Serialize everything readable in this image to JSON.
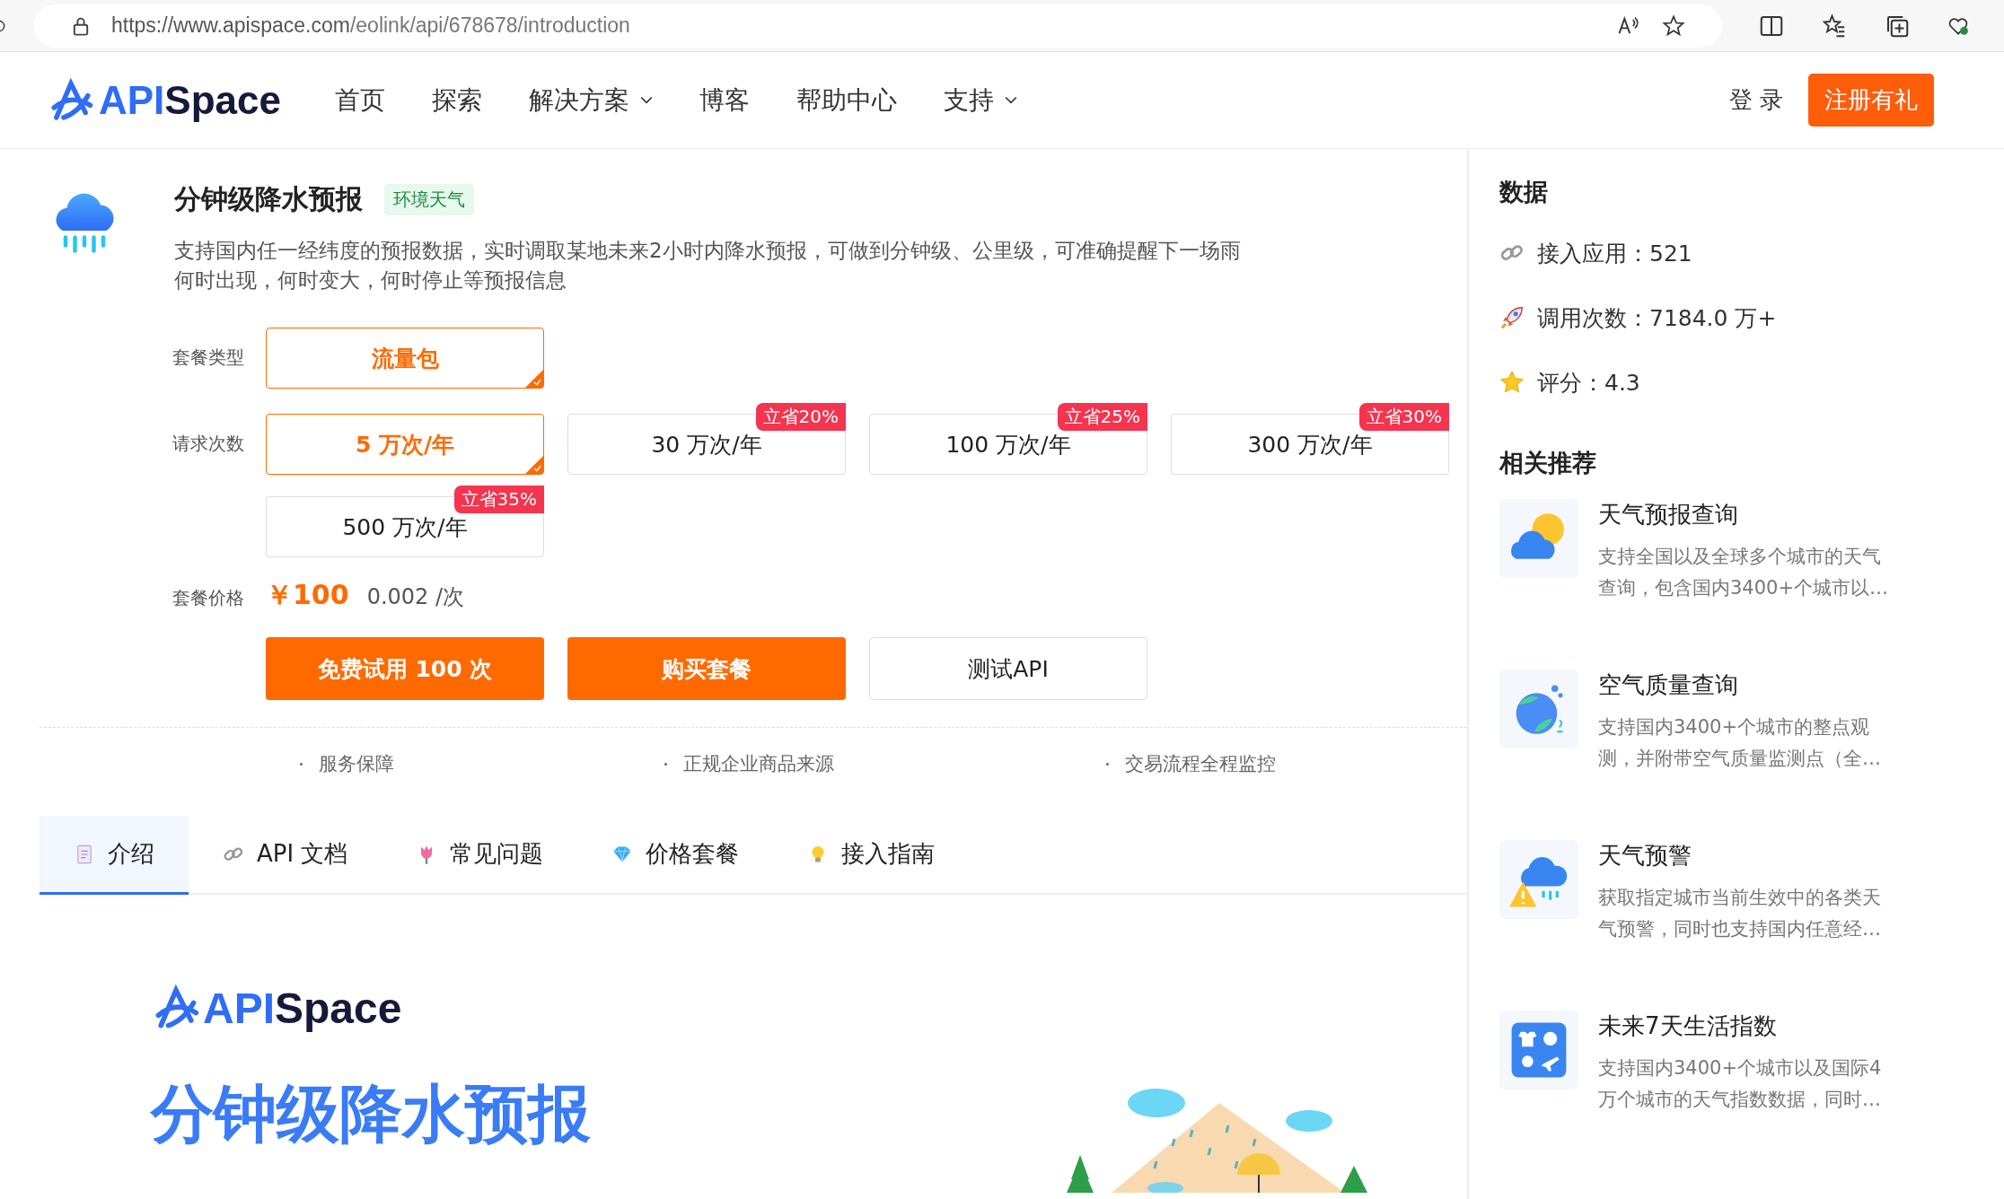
{
  "browser": {
    "url_host": "https://www.apispace.com",
    "url_path": "/eolink/api/678678/introduction"
  },
  "header": {
    "logo": {
      "prefix": "API",
      "suffix": "Space"
    },
    "nav": [
      {
        "label": "首页",
        "has_menu": false
      },
      {
        "label": "探索",
        "has_menu": false
      },
      {
        "label": "解决方案",
        "has_menu": true
      },
      {
        "label": "博客",
        "has_menu": false
      },
      {
        "label": "帮助中心",
        "has_menu": false
      },
      {
        "label": "支持",
        "has_menu": true
      }
    ],
    "login": "登 录",
    "register": "注册有礼"
  },
  "product": {
    "title": "分钟级降水预报",
    "tag": "环境天气",
    "description": "支持国内任一经纬度的预报数据，实时调取某地未来2小时内降水预报，可做到分钟级、公里级，可准确提醒下一场雨何时出现，何时变大，何时停止等预报信息",
    "package_type": {
      "label": "套餐类型",
      "options": [
        {
          "label": "流量包",
          "selected": true
        }
      ]
    },
    "request_count": {
      "label": "请求次数",
      "options": [
        {
          "label": "5 万次/年",
          "selected": true
        },
        {
          "label": "30 万次/年",
          "selected": false,
          "badge": "立省20%"
        },
        {
          "label": "100 万次/年",
          "selected": false,
          "badge": "立省25%"
        },
        {
          "label": "300 万次/年",
          "selected": false,
          "badge": "立省30%"
        },
        {
          "label": "500 万次/年",
          "selected": false,
          "badge": "立省35%"
        }
      ]
    },
    "price": {
      "label": "套餐价格",
      "amount": "￥100",
      "unit_price": "0.002 /次"
    },
    "buttons": [
      {
        "label": "免费试用 100 次",
        "kind": "primary"
      },
      {
        "label": "购买套餐",
        "kind": "primary"
      },
      {
        "label": "测试API",
        "kind": "outline"
      }
    ],
    "guarantees": [
      "服务保障",
      "正规企业商品来源",
      "交易流程全程监控"
    ]
  },
  "tabs": [
    {
      "label": "介绍",
      "kind": "doc",
      "selected": true
    },
    {
      "label": "API 文档",
      "kind": "link",
      "selected": false
    },
    {
      "label": "常见问题",
      "kind": "tulip",
      "selected": false
    },
    {
      "label": "价格套餐",
      "kind": "diamond",
      "selected": false
    },
    {
      "label": "接入指南",
      "kind": "bulb",
      "selected": false
    }
  ],
  "intro": {
    "logo": {
      "prefix": "API",
      "suffix": "Space"
    },
    "heading": "分钟级降水预报"
  },
  "sidebar": {
    "data_title": "数据",
    "stats": [
      {
        "kind": "link",
        "text": "接入应用：521"
      },
      {
        "kind": "rocket",
        "text": "调用次数：7184.0 万+"
      },
      {
        "kind": "star",
        "text": "评分：4.3"
      }
    ],
    "related_title": "相关推荐",
    "related": [
      {
        "kind": "sun-cloud",
        "title": "天气预报查询",
        "description": "支持全国以及全球多个城市的天气查询，包含国内3400+个城市以…"
      },
      {
        "kind": "globe",
        "title": "空气质量查询",
        "description": "支持国内3400+个城市的整点观测，并附带空气质量监测点（全…"
      },
      {
        "kind": "warning-cloud",
        "title": "天气预警",
        "description": "获取指定城市当前生效中的各类天气预警，同时也支持国内任意经…"
      },
      {
        "kind": "grid",
        "title": "未来7天生活指数",
        "description": "支持国内3400+个城市以及国际4万个城市的天气指数数据，同时…"
      }
    ]
  }
}
